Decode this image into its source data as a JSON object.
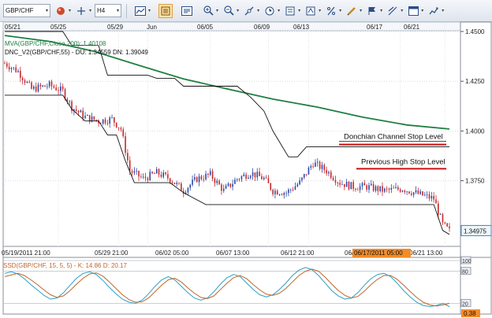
{
  "toolbar": {
    "symbol": "GBP/CHF",
    "timeframe": "H4",
    "buttons": [
      "record-icon",
      "crosshair-icon",
      "chart-type-icon",
      "active-tool-icon",
      "properties-icon",
      "zoom-in-icon",
      "zoom-out-icon",
      "draw-icon",
      "clock-icon",
      "notes-icon",
      "text-icon",
      "percentage-icon",
      "pencil-icon",
      "flag-icon",
      "trendlines-icon",
      "layout-icon",
      "indicators-icon"
    ],
    "dropdown_marker": "▾"
  },
  "colors": {
    "up_candle": "#2a46a8",
    "down_candle": "#c62828",
    "ma": "#1e7f42",
    "channel": "#111111",
    "stop_line": "#cc1111",
    "price_tag_bg": "#eef6fb",
    "price_tag_border": "#3a86c8",
    "date_tag_bg": "#f28c28",
    "osc_k": "#2aa0c8",
    "osc_d": "#c0662a"
  },
  "chart_data": [
    {
      "type": "candlestick",
      "symbol": "GBP/CHF",
      "timeframe": "H4",
      "top_date_labels": [
        "05/21",
        "05/25",
        "05/29",
        "Jun",
        "06/05",
        "06/09",
        "06/13",
        "06/17",
        "06/21"
      ],
      "bottom_time_labels": [
        "05/19/2011 21:00",
        "05/29 21:00",
        "06/02 05:00",
        "06/07 13:00",
        "06/12 21:00",
        "06/17/2011 05:00",
        "06/21 13:00"
      ],
      "crosshair_time_label": "06/17/2011 05:00",
      "ylim": [
        1.342,
        1.45
      ],
      "y_ticks": [
        "1.4500",
        "1.4250",
        "1.4000",
        "1.3750"
      ],
      "last_price": "1.34975",
      "indicators": [
        {
          "label": "MVA(GBP/CHF,Close,200): 1.40108",
          "kind": "moving-average"
        },
        {
          "label": "DNC_V2(GBP/CHF,55) - DU: 1.34559  DN: 1.39049",
          "kind": "donchian-channel"
        }
      ],
      "annotations": [
        {
          "text": "Donchian Channel Stop Level",
          "level": 1.3932
        },
        {
          "text": "Previous High Stop Level",
          "level": 1.381
        }
      ],
      "ma_points": [
        [
          0,
          1.448
        ],
        [
          20,
          1.445
        ],
        [
          40,
          1.44
        ],
        [
          60,
          1.433
        ],
        [
          80,
          1.4262
        ],
        [
          100,
          1.421
        ],
        [
          120,
          1.416
        ],
        [
          140,
          1.412
        ],
        [
          160,
          1.407
        ],
        [
          180,
          1.403
        ],
        [
          199,
          1.401
        ]
      ],
      "donchian_upper": [
        [
          0,
          1.45
        ],
        [
          26,
          1.45
        ],
        [
          30,
          1.443
        ],
        [
          42,
          1.443
        ],
        [
          46,
          1.428
        ],
        [
          64,
          1.428
        ],
        [
          68,
          1.4265
        ],
        [
          76,
          1.4265
        ],
        [
          80,
          1.4225
        ],
        [
          104,
          1.4225
        ],
        [
          110,
          1.417
        ],
        [
          116,
          1.41
        ],
        [
          120,
          1.4
        ],
        [
          127,
          1.387
        ],
        [
          131,
          1.387
        ],
        [
          135,
          1.392
        ],
        [
          199,
          1.392
        ]
      ],
      "donchian_lower": [
        [
          0,
          1.418
        ],
        [
          26,
          1.418
        ],
        [
          30,
          1.411
        ],
        [
          36,
          1.405
        ],
        [
          42,
          1.405
        ],
        [
          46,
          1.398
        ],
        [
          50,
          1.398
        ],
        [
          54,
          1.385
        ],
        [
          58,
          1.374
        ],
        [
          74,
          1.374
        ],
        [
          80,
          1.369
        ],
        [
          90,
          1.363
        ],
        [
          192,
          1.363
        ],
        [
          196,
          1.35
        ],
        [
          199,
          1.348
        ]
      ]
    },
    {
      "type": "line",
      "title": "SSD(GBP/CHF, 15, 5, 5) - K: 14.86  D: 20.17",
      "ylim": [
        0,
        100
      ],
      "levels": [
        100,
        80,
        20
      ],
      "y_ticks": [
        "100",
        "80",
        "20"
      ],
      "last_value_tag": "0.38",
      "series": [
        {
          "name": "K",
          "values": [
            76,
            79,
            75,
            66,
            55,
            45,
            35,
            28,
            30,
            40,
            54,
            67,
            76,
            79,
            74,
            63,
            50,
            38,
            28,
            22,
            20,
            26,
            38,
            52,
            64,
            70,
            64,
            52,
            40,
            30,
            26,
            30,
            42,
            56,
            68,
            74,
            70,
            58,
            46,
            36,
            32,
            36,
            46,
            58,
            72,
            82,
            87,
            83,
            72,
            58,
            44,
            34,
            28,
            30,
            40,
            54,
            66,
            74,
            76,
            70,
            58,
            44,
            32,
            22,
            16,
            14,
            16,
            20,
            14
          ]
        },
        {
          "name": "D",
          "values": [
            70,
            73,
            76,
            72,
            64,
            55,
            45,
            36,
            31,
            34,
            44,
            56,
            67,
            75,
            77,
            71,
            60,
            48,
            36,
            27,
            22,
            23,
            30,
            42,
            54,
            64,
            67,
            60,
            49,
            39,
            31,
            29,
            34,
            46,
            58,
            68,
            72,
            66,
            55,
            45,
            37,
            35,
            39,
            48,
            60,
            72,
            80,
            84,
            80,
            69,
            56,
            44,
            35,
            30,
            33,
            43,
            55,
            65,
            72,
            72,
            65,
            54,
            42,
            31,
            22,
            17,
            15,
            17,
            20
          ]
        }
      ]
    }
  ]
}
